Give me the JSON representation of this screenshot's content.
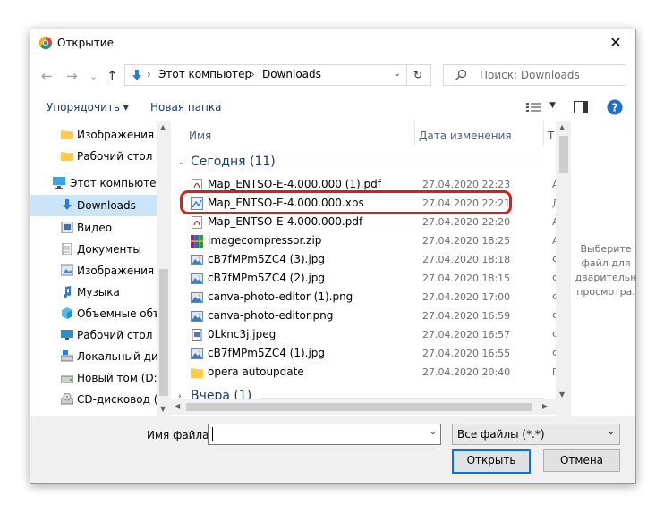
{
  "window": {
    "title": "Открытие",
    "close_glyph": "✕"
  },
  "nav": {
    "back": "←",
    "forward": "→",
    "up": "↑",
    "breadcrumb": [
      "Этот компьютер",
      "Downloads"
    ],
    "separator": "›",
    "refresh_glyph": "↻",
    "search_placeholder": "Поиск: Downloads"
  },
  "toolbar": {
    "organize": "Упорядочить ▾",
    "new_folder": "Новая папка"
  },
  "sidebar": {
    "items": [
      {
        "label": "Изображения",
        "icon": "folder-icon"
      },
      {
        "label": "Рабочий стол",
        "icon": "folder-icon"
      },
      {
        "label": "Этот компьютер",
        "icon": "computer-icon"
      },
      {
        "label": "Downloads",
        "icon": "download-icon",
        "selected": true
      },
      {
        "label": "Видео",
        "icon": "video-icon"
      },
      {
        "label": "Документы",
        "icon": "documents-icon"
      },
      {
        "label": "Изображения",
        "icon": "pictures-icon"
      },
      {
        "label": "Музыка",
        "icon": "music-icon"
      },
      {
        "label": "Объемные объ",
        "icon": "3d-objects-icon"
      },
      {
        "label": "Рабочий стол",
        "icon": "desktop-icon"
      },
      {
        "label": "Локальный дис",
        "icon": "drive-icon"
      },
      {
        "label": "Новый том (D:)",
        "icon": "drive-icon"
      },
      {
        "label": "CD-дисковод (F",
        "icon": "cd-drive-icon"
      }
    ]
  },
  "columns": {
    "name": "Имя",
    "date": "Дата изменения",
    "type": "Т"
  },
  "groups": {
    "today": "Сегодня (11)",
    "yesterday": "Вчера (1)"
  },
  "files": [
    {
      "name": "Map_ENTSO-E-4.000.000 (1).pdf",
      "date": "27.04.2020 22:23",
      "type": "A",
      "icon": "pdf-icon"
    },
    {
      "name": "Map_ENTSO-E-4.000.000.xps",
      "date": "27.04.2020 22:21",
      "type": "Д",
      "icon": "xps-icon",
      "highlighted": true
    },
    {
      "name": "Map_ENTSO-E-4.000.000.pdf",
      "date": "27.04.2020 22:20",
      "type": "A",
      "icon": "pdf-icon"
    },
    {
      "name": "imagecompressor.zip",
      "date": "27.04.2020 18:25",
      "type": "A",
      "icon": "archive-icon"
    },
    {
      "name": "cB7fMPm5ZC4 (3).jpg",
      "date": "27.04.2020 18:18",
      "type": "Ф",
      "icon": "image-icon"
    },
    {
      "name": "cB7fMPm5ZC4 (2).jpg",
      "date": "27.04.2020 18:15",
      "type": "Ф",
      "icon": "image-icon"
    },
    {
      "name": "canva-photo-editor (1).png",
      "date": "27.04.2020 17:00",
      "type": "Ф",
      "icon": "image-icon"
    },
    {
      "name": "canva-photo-editor.png",
      "date": "27.04.2020 16:59",
      "type": "Ф",
      "icon": "image-icon"
    },
    {
      "name": "0Lknc3j.jpeg",
      "date": "27.04.2020 16:57",
      "type": "Ф",
      "icon": "jpeg-icon"
    },
    {
      "name": "cB7fMPm5ZC4 (1).jpg",
      "date": "27.04.2020 16:55",
      "type": "Ф",
      "icon": "image-icon"
    },
    {
      "name": "opera autoupdate",
      "date": "27.04.2020 20:40",
      "type": "П",
      "icon": "folder-icon"
    }
  ],
  "preview": {
    "text": "Выберите\nфайл для\nдварительн\nпросмотра."
  },
  "footer": {
    "filename_label": "Имя файла:",
    "filename_value": "",
    "filetype": "Все файлы (*.*)",
    "open": "Открыть",
    "cancel": "Отмена"
  },
  "colors": {
    "accent": "#0078d7",
    "highlight": "#e01919",
    "selection": "#cce4f7"
  }
}
